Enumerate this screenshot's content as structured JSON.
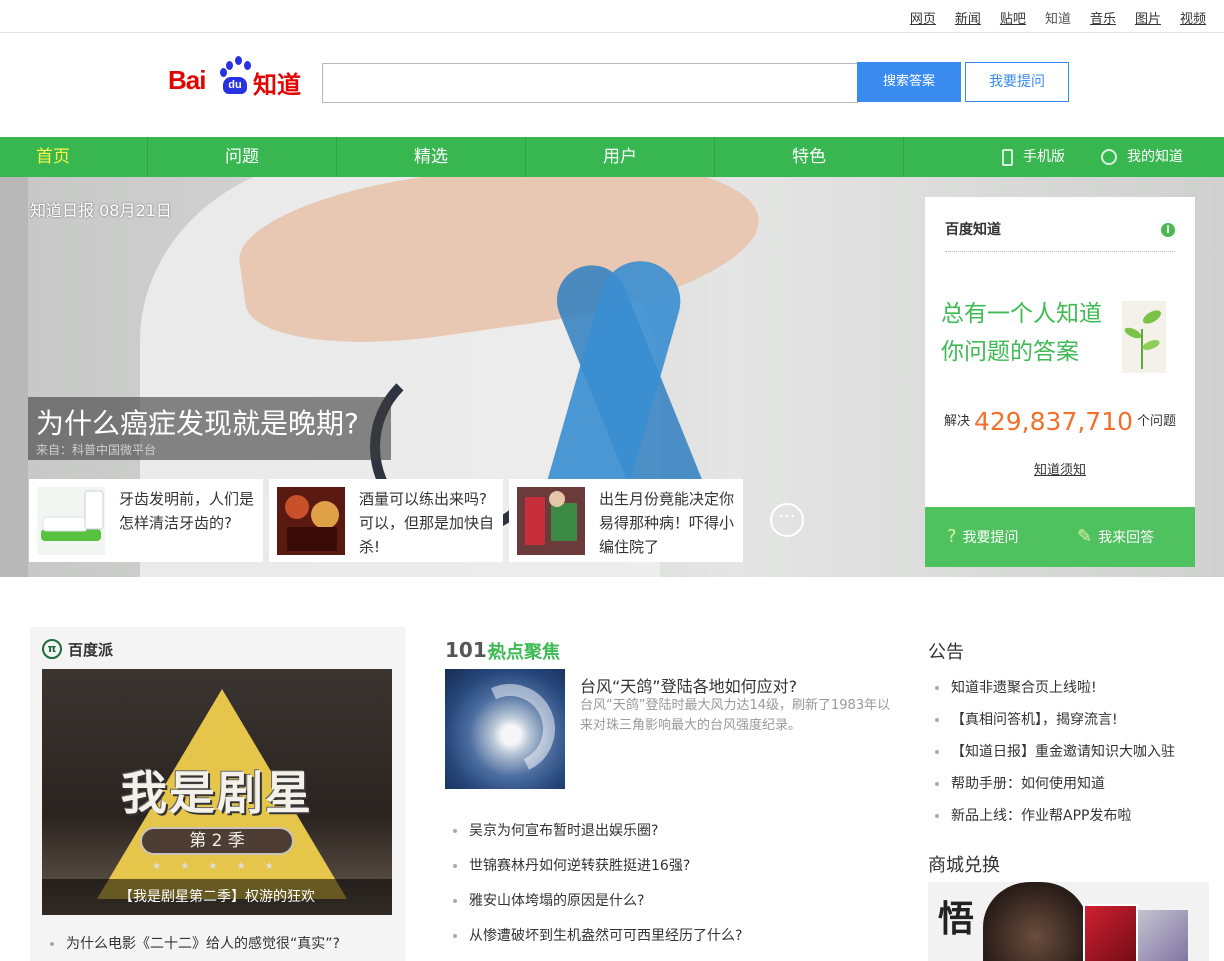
{
  "toplinks": {
    "items": [
      {
        "label": "网页"
      },
      {
        "label": "新闻"
      },
      {
        "label": "贴吧"
      },
      {
        "label": "知道"
      },
      {
        "label": "音乐"
      },
      {
        "label": "图片"
      },
      {
        "label": "视频"
      }
    ]
  },
  "header": {
    "logo_text_bai": "Bai",
    "logo_text_du": "du",
    "logo_text_zhidao": "知道",
    "search_value": "",
    "search_button": "搜索答案",
    "ask_button": "我要提问"
  },
  "nav": {
    "items": [
      {
        "label": "首页"
      },
      {
        "label": "问题"
      },
      {
        "label": "精选"
      },
      {
        "label": "用户"
      },
      {
        "label": "特色"
      }
    ],
    "mobile": "手机版",
    "my_zhidao": "我的知道"
  },
  "banner": {
    "date": "知道日报 08月21日",
    "headline": "为什么癌症发现就是晚期?",
    "source": "来自：科普中国微平台",
    "cards": [
      {
        "text": "牙齿发明前，人们是怎样清洁牙齿的?"
      },
      {
        "text": "酒量可以练出来吗?可以，但那是加快自杀!"
      },
      {
        "text": "出生月份竟能决定你易得那种病！吓得小编住院了"
      }
    ],
    "more": "···"
  },
  "info_panel": {
    "title": "百度知道",
    "slogan_line1": "总有一个人知道",
    "slogan_line2": "你问题的答案",
    "solved_prefix": "解决",
    "solved_count": "429,837,710",
    "solved_suffix": "个问题",
    "must_know": "知道须知",
    "ask": "我要提问",
    "answer": "我来回答"
  },
  "baidu_pai": {
    "title": "百度派",
    "poster_title": "我是剧星",
    "poster_season": "第 2 季",
    "poster_stars": "★ ★ ★ ★ ★",
    "caption": "【我是剧星第二季】权游的狂欢",
    "list": [
      {
        "text": "为什么电影《二十二》给人的感觉很“真实”?"
      }
    ]
  },
  "hot_focus": {
    "logo": "101",
    "logo_unit": "℃",
    "title": "热点聚焦",
    "lead_title": "台风“天鸽”登陆各地如何应对?",
    "lead_desc": "台风“天鸽”登陆时最大风力达14级，刷新了1983年以来对珠三角影响最大的台风强度纪录。",
    "items": [
      {
        "text": "吴京为何宣布暂时退出娱乐圈?"
      },
      {
        "text": "世锦赛林丹如何逆转获胜挺进16强?"
      },
      {
        "text": "雅安山体垮塌的原因是什么?"
      },
      {
        "text": "从惨遭破坏到生机盎然可可西里经历了什么?"
      }
    ]
  },
  "notice": {
    "title": "公告",
    "items": [
      {
        "text": "知道非遗聚合页上线啦!"
      },
      {
        "text": "【真相问答机】，揭穿流言!"
      },
      {
        "text": "【知道日报】重金邀请知识大咖入驻"
      },
      {
        "text": "帮助手册：如何使用知道"
      },
      {
        "text": "新品上线：作业帮APP发布啦"
      }
    ]
  },
  "shop": {
    "title": "商城兑换"
  },
  "colors": {
    "nav_green": "#38b750",
    "active_yellow": "#fff74a",
    "search_blue": "#3a8bef",
    "count_orange": "#f0702c",
    "logo_red": "#e10601",
    "logo_blue": "#2932e1"
  }
}
